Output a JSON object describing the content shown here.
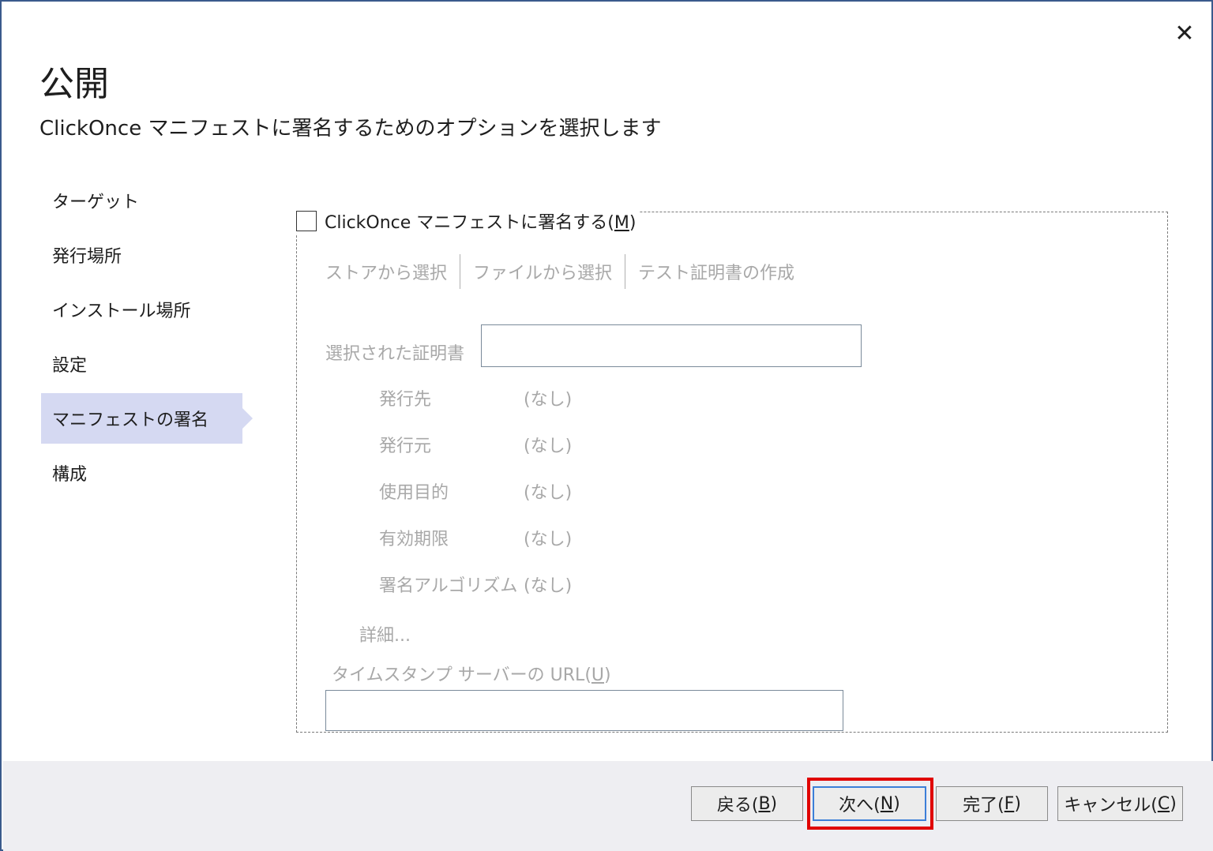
{
  "window": {
    "title": "公開",
    "subtitle": "ClickOnce マニフェストに署名するためのオプションを選択します",
    "close_glyph": "✕"
  },
  "nav": {
    "items": [
      {
        "label": "ターゲット"
      },
      {
        "label": "発行場所"
      },
      {
        "label": "インストール場所"
      },
      {
        "label": "設定"
      },
      {
        "label": "マニフェストの署名"
      },
      {
        "label": "構成"
      }
    ],
    "selected": "マニフェストの署名"
  },
  "signing": {
    "checkbox_label_prefix": "ClickOnce マニフェストに署名する(",
    "checkbox_accel": "M",
    "checkbox_label_suffix": ")",
    "checked": false,
    "cert_buttons": [
      "ストアから選択",
      "ファイルから選択",
      "テスト証明書の作成"
    ],
    "selected_cert_label": "選択された証明書",
    "selected_cert_value": "",
    "info": [
      {
        "key": "発行先",
        "value": "(なし)"
      },
      {
        "key": "発行元",
        "value": "(なし)"
      },
      {
        "key": "使用目的",
        "value": "(なし)"
      },
      {
        "key": "有効期限",
        "value": "(なし)"
      },
      {
        "key": "署名アルゴリズム",
        "value": "(なし)"
      }
    ],
    "details_label": "詳細...",
    "timestamp_label_prefix": "タイムスタンプ サーバーの URL(",
    "timestamp_accel": "U",
    "timestamp_label_suffix": ")",
    "timestamp_value": ""
  },
  "footer": {
    "back": {
      "prefix": "戻る(",
      "accel": "B",
      "suffix": ")"
    },
    "next": {
      "prefix": "次へ(",
      "accel": "N",
      "suffix": ")"
    },
    "finish": {
      "prefix": "完了(",
      "accel": "F",
      "suffix": ")"
    },
    "cancel": {
      "prefix": "キャンセル(",
      "accel": "C",
      "suffix": ")"
    }
  },
  "colors": {
    "highlight": "#e00000",
    "nav_selected": "#d5d9f2",
    "primary_border": "#3c7fd8"
  }
}
